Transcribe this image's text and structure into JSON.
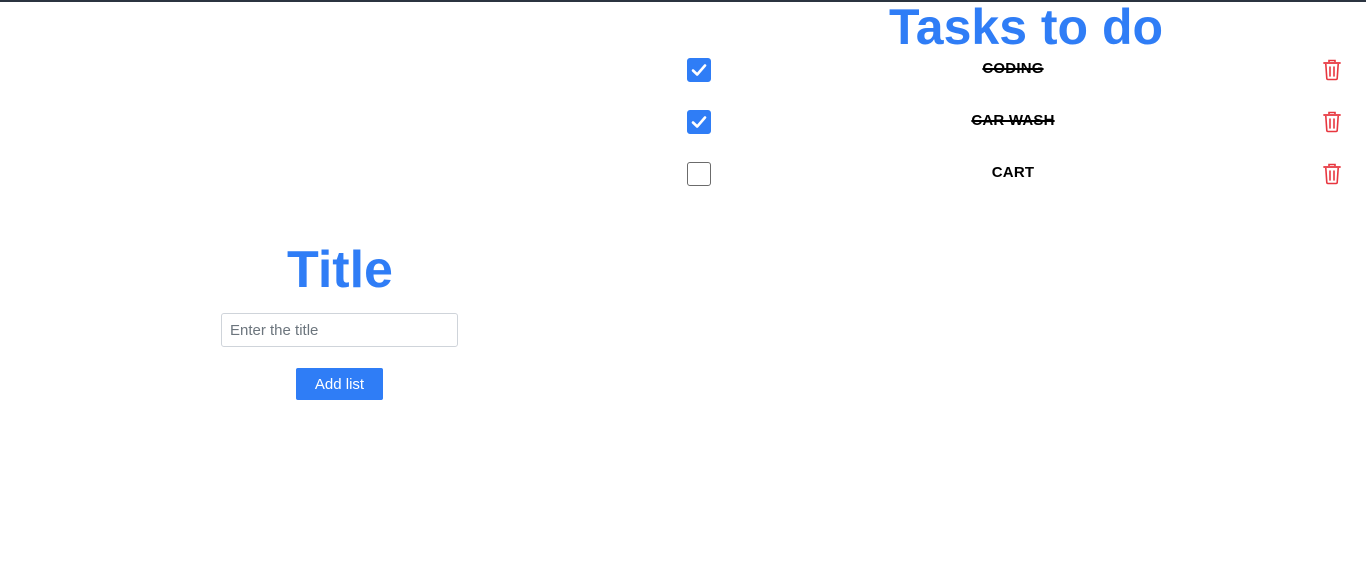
{
  "form": {
    "title": "Title",
    "input_placeholder": "Enter the title",
    "input_value": "",
    "add_button_label": "Add list"
  },
  "tasks": {
    "heading": "Tasks to do",
    "items": [
      {
        "label": "CODING",
        "checked": true
      },
      {
        "label": "CAR WASH",
        "checked": true
      },
      {
        "label": "CART",
        "checked": false
      }
    ]
  },
  "icons": {
    "checkbox_check": "check-icon",
    "delete": "trash-icon"
  },
  "colors": {
    "accent": "#2f7df6",
    "delete": "#e8363f",
    "text": "#000000"
  }
}
